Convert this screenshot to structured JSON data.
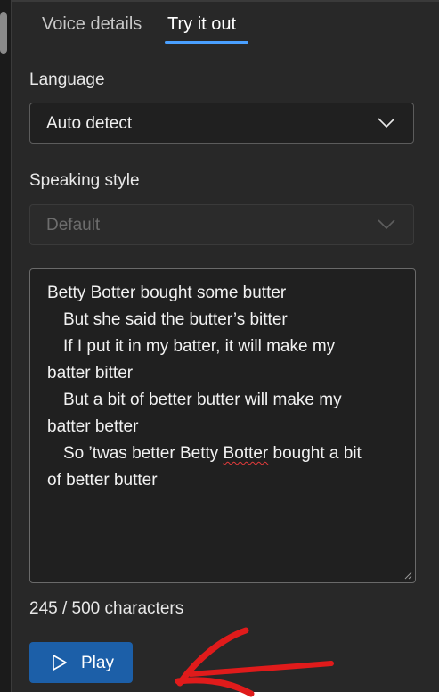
{
  "tabs": [
    {
      "label": "Voice details",
      "active": false
    },
    {
      "label": "Try it out",
      "active": true
    }
  ],
  "language": {
    "label": "Language",
    "value": "Auto detect"
  },
  "speaking_style": {
    "label": "Speaking style",
    "value": "Default",
    "disabled": true
  },
  "text_input": {
    "lines": [
      "Betty Botter bought some butter",
      "But she said the butter’s bitter",
      "If I put it in my batter, it will make my",
      "batter bitter",
      "But a bit of better butter will make my",
      "batter better",
      "So ’twas better Betty ",
      "Botter",
      " bought a bit",
      "of better butter"
    ]
  },
  "char_counter": "245 / 500 characters",
  "play_button": {
    "label": "Play"
  },
  "icons": {
    "dropdown": "chevron-down-icon",
    "play": "play-icon",
    "annotation": "red-arrow-annotation"
  },
  "colors": {
    "accent": "#4aa0ff",
    "primary_button": "#1c5fa8",
    "annotation": "#e01b1b",
    "spellcheck": "#e23b3b"
  }
}
